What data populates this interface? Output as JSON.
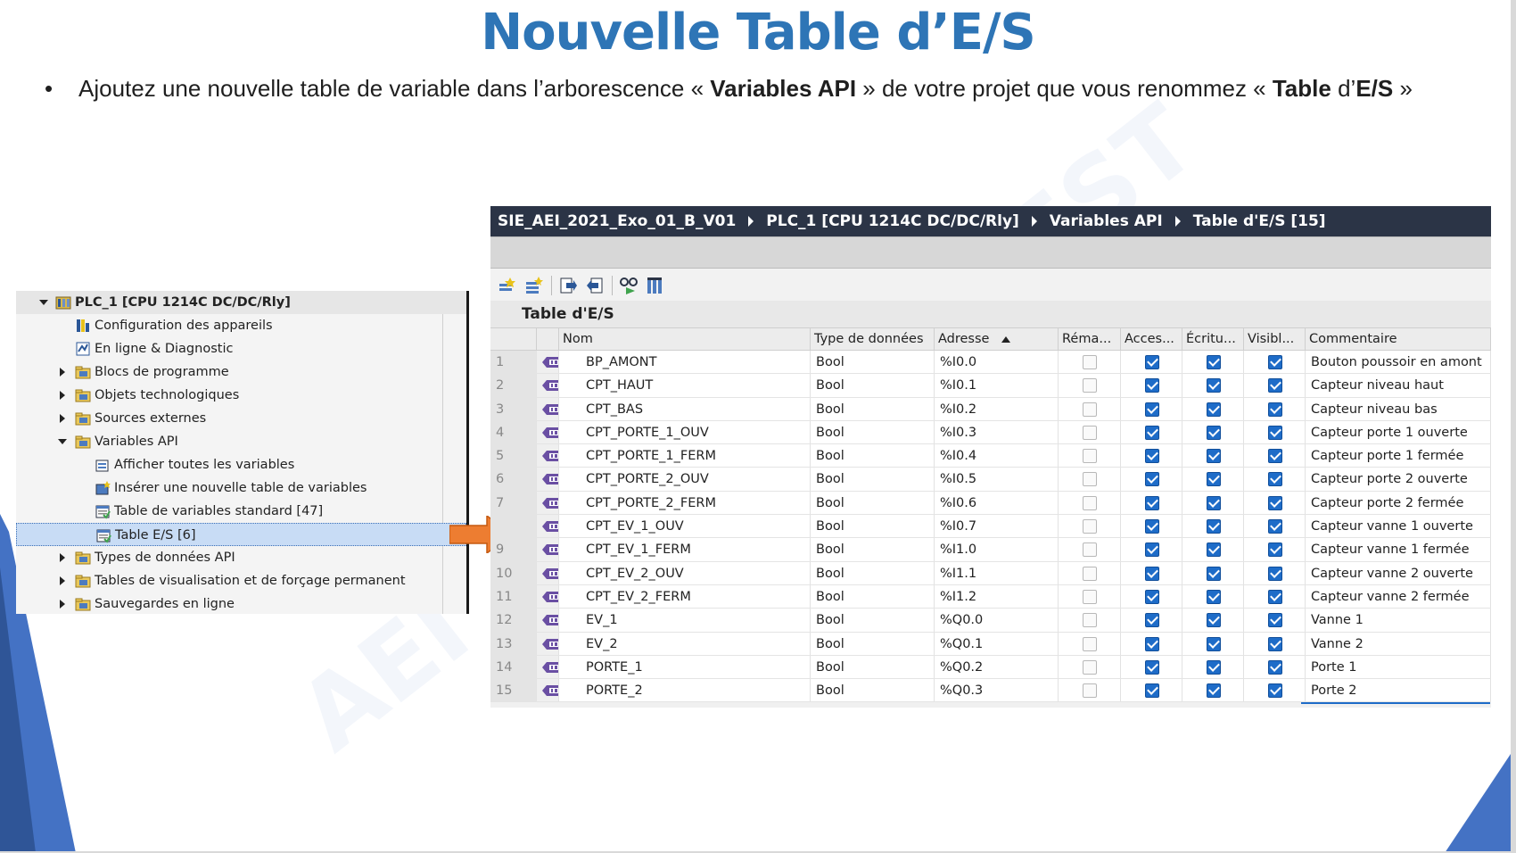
{
  "slide": {
    "title": "Nouvelle Table d’E/S",
    "bullet_marker": "•",
    "bullet_parts": {
      "p1": "Ajoutez une nouvelle table de variable dans l’arborescence « ",
      "b1": "Variables API",
      "p2": " » de votre projet que vous renommez « ",
      "b2": "Table",
      "p3": " d’",
      "b3": "E/S",
      "p4": " »"
    },
    "watermark_left": "AEI",
    "watermark_right": "EST",
    "colors": {
      "title": "#2e75b6",
      "accent_shape": "#4472c4",
      "arrow": "#ed7d31"
    }
  },
  "tree": {
    "root": "PLC_1 [CPU 1214C DC/DC/Rly]",
    "items": [
      {
        "label": "Configuration des appareils",
        "icon": "device-config-icon",
        "level": 1,
        "expander": "none"
      },
      {
        "label": "En ligne & Diagnostic",
        "icon": "online-diagnostic-icon",
        "level": 1,
        "expander": "none"
      },
      {
        "label": "Blocs de programme",
        "icon": "folder-icon",
        "level": 1,
        "expander": "collapsed"
      },
      {
        "label": "Objets technologiques",
        "icon": "folder-icon",
        "level": 1,
        "expander": "collapsed"
      },
      {
        "label": "Sources externes",
        "icon": "folder-icon",
        "level": 1,
        "expander": "collapsed"
      },
      {
        "label": "Variables API",
        "icon": "folder-icon",
        "level": 1,
        "expander": "expanded"
      },
      {
        "label": "Afficher toutes les variables",
        "icon": "show-variables-icon",
        "level": 2,
        "expander": "none"
      },
      {
        "label": "Insérer une nouvelle table de variables",
        "icon": "new-table-icon",
        "level": 2,
        "expander": "none"
      },
      {
        "label": "Table de variables standard [47]",
        "icon": "variable-table-icon",
        "level": 2,
        "expander": "none"
      },
      {
        "label": "Table E/S [6]",
        "icon": "variable-table-icon",
        "level": 2,
        "expander": "none",
        "selected": true
      },
      {
        "label": "Types de données API",
        "icon": "folder-icon",
        "level": 1,
        "expander": "collapsed"
      },
      {
        "label": "Tables de visualisation et de forçage permanent",
        "icon": "folder-icon",
        "level": 1,
        "expander": "collapsed"
      },
      {
        "label": "Sauvegardes en ligne",
        "icon": "folder-icon",
        "level": 1,
        "expander": "collapsed"
      }
    ]
  },
  "editor": {
    "breadcrumb": [
      "SIE_AEI_2021_Exo_01_B_V01",
      "PLC_1 [CPU 1214C DC/DC/Rly]",
      "Variables API",
      "Table d'E/S [15]"
    ],
    "table_title": "Table d'E/S",
    "toolbar_icons": [
      "add-row-icon",
      "insert-row-icon",
      "export-icon",
      "import-icon",
      "monitor-glasses-icon",
      "all-columns-icon"
    ],
    "columns": {
      "nom": "Nom",
      "type": "Type de données",
      "adresse": "Adresse",
      "rema": "Réma...",
      "acces": "Acces...",
      "ecritu": "Écritu...",
      "visibl": "Visibl...",
      "commentaire": "Commentaire"
    },
    "sort_column": "Adresse",
    "rows": [
      {
        "n": "1",
        "nom": "BP_AMONT",
        "type": "Bool",
        "adresse": "%I0.0",
        "rema": false,
        "acces": true,
        "ecritu": true,
        "visibl": true,
        "commentaire": "Bouton poussoir en amont"
      },
      {
        "n": "2",
        "nom": "CPT_HAUT",
        "type": "Bool",
        "adresse": "%I0.1",
        "rema": false,
        "acces": true,
        "ecritu": true,
        "visibl": true,
        "commentaire": "Capteur niveau haut"
      },
      {
        "n": "3",
        "nom": "CPT_BAS",
        "type": "Bool",
        "adresse": "%I0.2",
        "rema": false,
        "acces": true,
        "ecritu": true,
        "visibl": true,
        "commentaire": "Capteur niveau bas"
      },
      {
        "n": "4",
        "nom": "CPT_PORTE_1_OUV",
        "type": "Bool",
        "adresse": "%I0.3",
        "rema": false,
        "acces": true,
        "ecritu": true,
        "visibl": true,
        "commentaire": "Capteur porte 1 ouverte"
      },
      {
        "n": "5",
        "nom": "CPT_PORTE_1_FERM",
        "type": "Bool",
        "adresse": "%I0.4",
        "rema": false,
        "acces": true,
        "ecritu": true,
        "visibl": true,
        "commentaire": "Capteur porte 1 fermée"
      },
      {
        "n": "6",
        "nom": "CPT_PORTE_2_OUV",
        "type": "Bool",
        "adresse": "%I0.5",
        "rema": false,
        "acces": true,
        "ecritu": true,
        "visibl": true,
        "commentaire": "Capteur porte 2 ouverte"
      },
      {
        "n": "7",
        "nom": "CPT_PORTE_2_FERM",
        "type": "Bool",
        "adresse": "%I0.6",
        "rema": false,
        "acces": true,
        "ecritu": true,
        "visibl": true,
        "commentaire": "Capteur porte 2 fermée"
      },
      {
        "n": "",
        "nom": "CPT_EV_1_OUV",
        "type": "Bool",
        "adresse": "%I0.7",
        "rema": false,
        "acces": true,
        "ecritu": true,
        "visibl": true,
        "commentaire": "Capteur vanne 1 ouverte"
      },
      {
        "n": "9",
        "nom": "CPT_EV_1_FERM",
        "type": "Bool",
        "adresse": "%I1.0",
        "rema": false,
        "acces": true,
        "ecritu": true,
        "visibl": true,
        "commentaire": "Capteur vanne 1 fermée"
      },
      {
        "n": "10",
        "nom": "CPT_EV_2_OUV",
        "type": "Bool",
        "adresse": "%I1.1",
        "rema": false,
        "acces": true,
        "ecritu": true,
        "visibl": true,
        "commentaire": "Capteur vanne 2 ouverte"
      },
      {
        "n": "11",
        "nom": "CPT_EV_2_FERM",
        "type": "Bool",
        "adresse": "%I1.2",
        "rema": false,
        "acces": true,
        "ecritu": true,
        "visibl": true,
        "commentaire": "Capteur vanne 2 fermée"
      },
      {
        "n": "12",
        "nom": "EV_1",
        "type": "Bool",
        "adresse": "%Q0.0",
        "rema": false,
        "acces": true,
        "ecritu": true,
        "visibl": true,
        "commentaire": "Vanne 1"
      },
      {
        "n": "13",
        "nom": "EV_2",
        "type": "Bool",
        "adresse": "%Q0.1",
        "rema": false,
        "acces": true,
        "ecritu": true,
        "visibl": true,
        "commentaire": "Vanne 2"
      },
      {
        "n": "14",
        "nom": "PORTE_1",
        "type": "Bool",
        "adresse": "%Q0.2",
        "rema": false,
        "acces": true,
        "ecritu": true,
        "visibl": true,
        "commentaire": "Porte 1"
      },
      {
        "n": "15",
        "nom": "PORTE_2",
        "type": "Bool",
        "adresse": "%Q0.3",
        "rema": false,
        "acces": true,
        "ecritu": true,
        "visibl": true,
        "commentaire": "Porte 2"
      }
    ]
  }
}
